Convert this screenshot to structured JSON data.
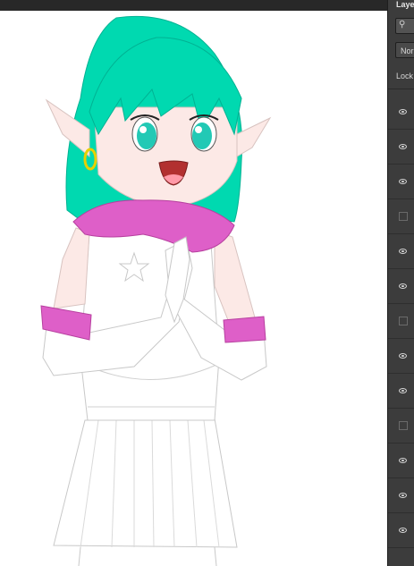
{
  "layers_panel": {
    "title": "Laye",
    "search_icon": "search-icon",
    "blend_mode": "Nor",
    "lock_label": "Lock",
    "rows": [
      {
        "visible": true
      },
      {
        "visible": true
      },
      {
        "visible": true
      },
      {
        "visible": false
      },
      {
        "visible": true
      },
      {
        "visible": true
      },
      {
        "visible": false
      },
      {
        "visible": true
      },
      {
        "visible": true
      },
      {
        "visible": false
      },
      {
        "visible": true
      },
      {
        "visible": true
      },
      {
        "visible": true
      }
    ]
  },
  "colors": {
    "hair": "#00d9b0",
    "scarf": "#de5fc8",
    "skin": "#fce9e6",
    "outline": "#bdbdbd",
    "panel_bg": "#3c3c3c"
  }
}
